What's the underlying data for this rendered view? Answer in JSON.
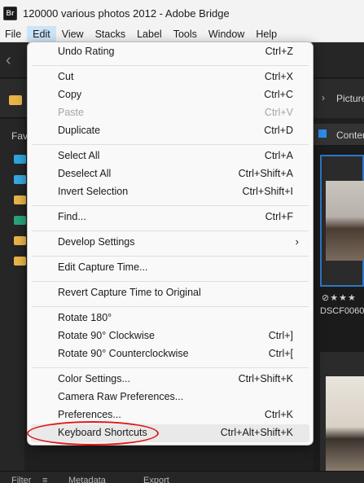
{
  "window": {
    "app_badge": "Br",
    "title": "120000 various photos 2012 - Adobe Bridge"
  },
  "menubar": {
    "items": [
      "File",
      "Edit",
      "View",
      "Stacks",
      "Label",
      "Tools",
      "Window",
      "Help"
    ]
  },
  "path": {
    "right_label": "Picture"
  },
  "panels": {
    "favorites_tab": "Fav",
    "content_tab": "Conten"
  },
  "thumbnail": {
    "filename": "DSCF0060.",
    "rating": "⊘★★★"
  },
  "bottom_tabs": {
    "filter": "Filter",
    "metadata": "Metadata",
    "export": "Export"
  },
  "edit_menu": {
    "undo_rating": {
      "label": "Undo Rating",
      "shortcut": "Ctrl+Z"
    },
    "cut": {
      "label": "Cut",
      "shortcut": "Ctrl+X"
    },
    "copy": {
      "label": "Copy",
      "shortcut": "Ctrl+C"
    },
    "paste": {
      "label": "Paste",
      "shortcut": "Ctrl+V"
    },
    "duplicate": {
      "label": "Duplicate",
      "shortcut": "Ctrl+D"
    },
    "select_all": {
      "label": "Select All",
      "shortcut": "Ctrl+A"
    },
    "deselect_all": {
      "label": "Deselect All",
      "shortcut": "Ctrl+Shift+A"
    },
    "invert_selection": {
      "label": "Invert Selection",
      "shortcut": "Ctrl+Shift+I"
    },
    "find": {
      "label": "Find...",
      "shortcut": "Ctrl+F"
    },
    "develop_settings": {
      "label": "Develop Settings",
      "submenu": "›"
    },
    "edit_capture_time": {
      "label": "Edit Capture Time..."
    },
    "revert_capture_time": {
      "label": "Revert Capture Time to Original"
    },
    "rotate_180": {
      "label": "Rotate 180°"
    },
    "rotate_cw": {
      "label": "Rotate 90° Clockwise",
      "shortcut": "Ctrl+]"
    },
    "rotate_ccw": {
      "label": "Rotate 90° Counterclockwise",
      "shortcut": "Ctrl+["
    },
    "color_settings": {
      "label": "Color Settings...",
      "shortcut": "Ctrl+Shift+K"
    },
    "camera_raw_prefs": {
      "label": "Camera Raw Preferences..."
    },
    "preferences": {
      "label": "Preferences...",
      "shortcut": "Ctrl+K"
    },
    "keyboard_shortcuts": {
      "label": "Keyboard Shortcuts",
      "shortcut": "Ctrl+Alt+Shift+K"
    }
  },
  "colors": {
    "accent_blue": "#2d8ceb",
    "annotation_red": "#e01919",
    "menu_bg": "#f9f9f9"
  }
}
